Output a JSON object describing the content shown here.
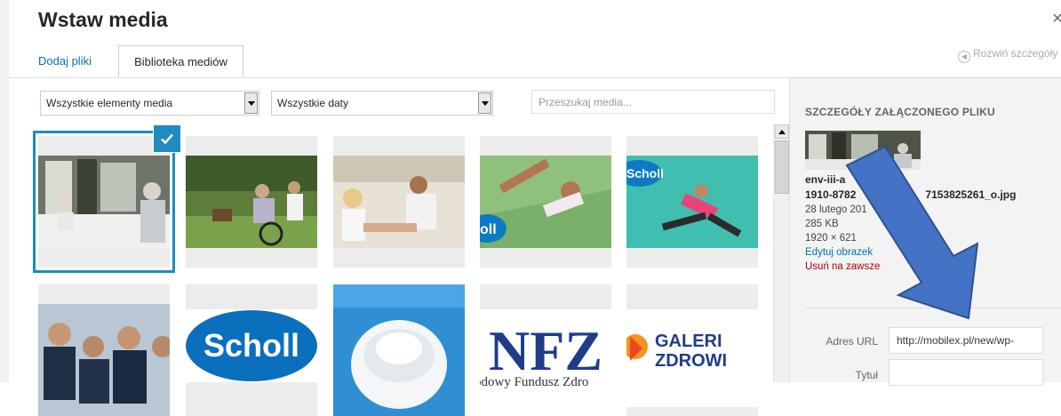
{
  "modal": {
    "title": "Wstaw media",
    "close_symbol": "×",
    "expand_label": "Rozwiń szczegóły",
    "expand_icon": "circle-left-arrow-icon"
  },
  "tabs": [
    {
      "label": "Dodaj pliki",
      "active": false
    },
    {
      "label": "Biblioteka mediów",
      "active": true
    }
  ],
  "filters": {
    "type_selected": "Wszystkie elementy media",
    "date_selected": "Wszystkie daty",
    "search_placeholder": "Przeszukaj media..."
  },
  "thumbnails": [
    {
      "name": "photo-dining-room",
      "selected": true
    },
    {
      "name": "photo-wheelchair-garden",
      "selected": false
    },
    {
      "name": "photo-foot-care",
      "selected": false
    },
    {
      "name": "photo-scholl-woman-lying",
      "selected": false,
      "logo": "Scholl"
    },
    {
      "name": "photo-scholl-woman-jumping",
      "selected": false,
      "logo": "Scholl"
    },
    {
      "name": "photo-team-group",
      "selected": false
    },
    {
      "name": "logo-scholl",
      "selected": false,
      "logo": "Scholl"
    },
    {
      "name": "photo-toilet-seat",
      "selected": false
    },
    {
      "name": "logo-nfz",
      "selected": false,
      "logo": "NFZ",
      "caption": "odowy Fundusz Zdro"
    },
    {
      "name": "logo-galeria-zdrowia",
      "selected": false,
      "logo": "GALERI ZDROWI"
    }
  ],
  "details": {
    "heading": "SZCZEGÓŁY ZAŁĄCZONEGO PLIKU",
    "filename_line1": "env-iii-a",
    "filename_line2": "1910-8782",
    "filename_tail": "7153825261_o.jpg",
    "date": "28 lutego 201",
    "size": "285 KB",
    "dimensions": "1920 × 621",
    "edit_label": "Edytuj obrazek",
    "delete_label": "Usuń na zawsze",
    "url_label": "Adres URL",
    "url_value": "http://mobilex.pl/new/wp-",
    "title_label": "Tytuł",
    "title_value": ""
  },
  "colors": {
    "accent": "#1e8cbe",
    "link": "#0073aa",
    "delete": "#aa0000",
    "annotation_arrow": "#4472c4"
  }
}
